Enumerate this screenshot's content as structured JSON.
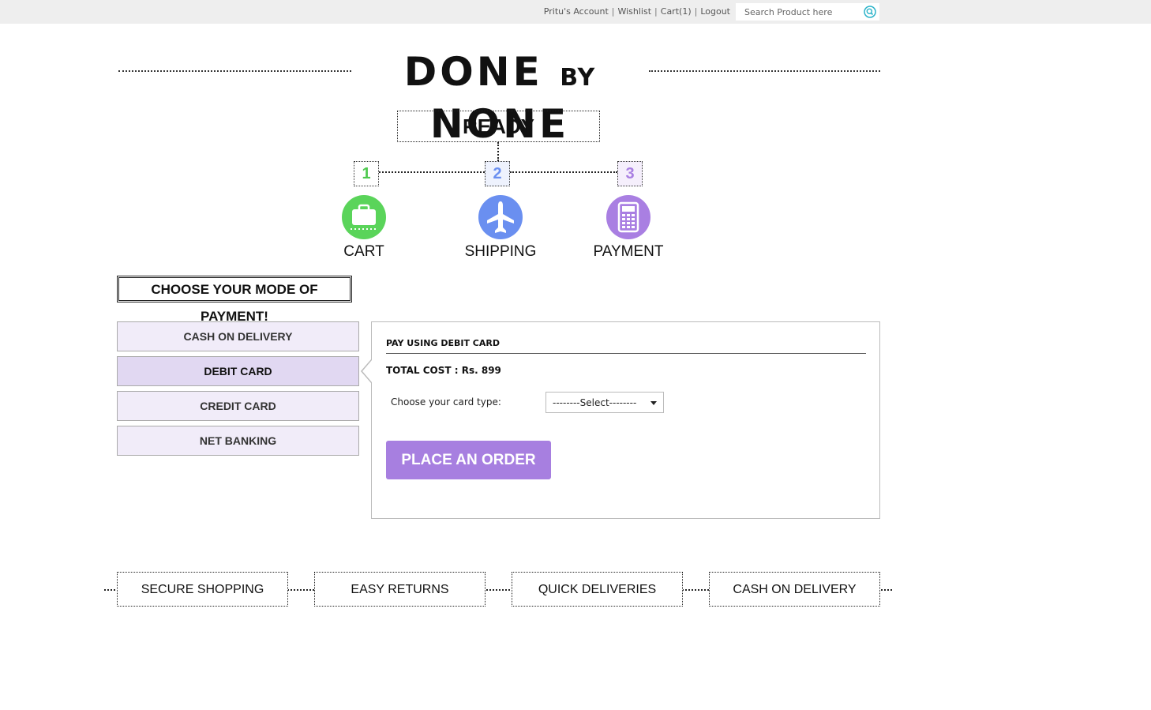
{
  "topbar": {
    "account": "Pritu's Account",
    "wishlist": "Wishlist",
    "cart": "Cart(1)",
    "logout": "Logout",
    "separator": "|",
    "search_placeholder": "Search Product here"
  },
  "brand": {
    "done": "DONE",
    "by": "BY",
    "none": "NONE"
  },
  "checkout": {
    "status": "READY",
    "steps": [
      {
        "number": "1",
        "label": "CART",
        "icon": "cart-icon",
        "color": "#5ad45a"
      },
      {
        "number": "2",
        "label": "SHIPPING",
        "icon": "airplane-icon",
        "color": "#6a8ff0"
      },
      {
        "number": "3",
        "label": "PAYMENT",
        "icon": "calculator-icon",
        "color": "#a97fe2"
      }
    ]
  },
  "payment": {
    "title": "CHOOSE YOUR MODE OF PAYMENT!",
    "methods": [
      "CASH ON DELIVERY",
      "DEBIT CARD",
      "CREDIT CARD",
      "NET BANKING"
    ],
    "active_method": "DEBIT CARD",
    "panel": {
      "heading": "PAY USING DEBIT CARD",
      "total": "TOTAL COST : Rs. 899",
      "card_type_label": "Choose your card type:",
      "card_type_value": "--------Select--------",
      "submit": "PLACE AN ORDER"
    }
  },
  "features": [
    "SECURE SHOPPING",
    "EASY RETURNS",
    "QUICK DELIVERIES",
    "CASH ON DELIVERY"
  ],
  "colors": {
    "accent": "#a77fe0",
    "tab_bg": "#f1ecf9",
    "tab_active": "#e1d8f2",
    "topbar": "#eeeeee"
  }
}
